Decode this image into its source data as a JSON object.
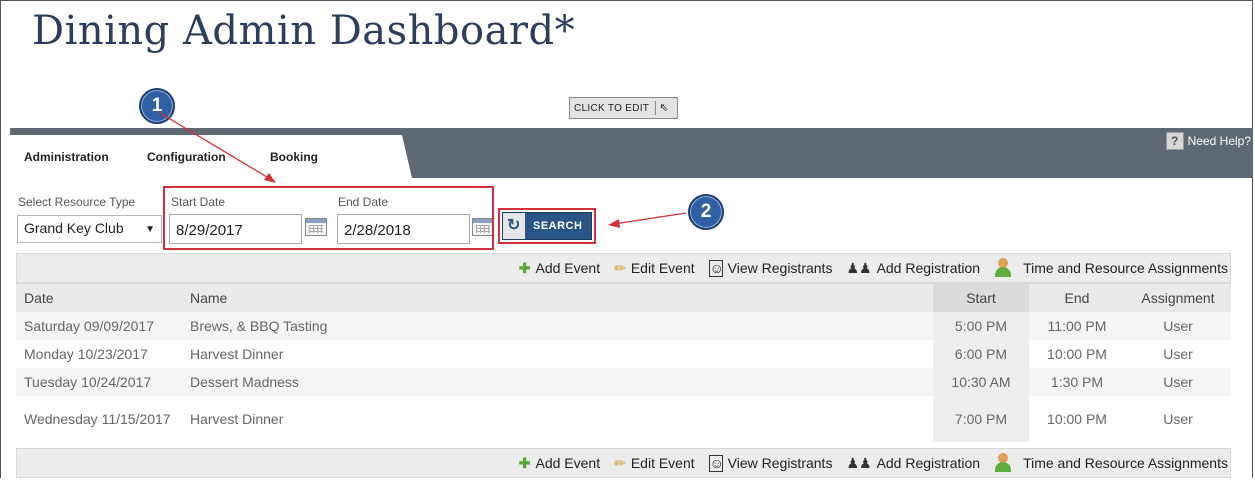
{
  "page": {
    "title": "Dining Admin Dashboard*"
  },
  "edit_button": {
    "label": "CLICK TO EDIT"
  },
  "tabs": [
    {
      "label": "Administration"
    },
    {
      "label": "Configuration"
    },
    {
      "label": "Booking"
    }
  ],
  "help": {
    "label": "Need Help?",
    "icon": "help-icon"
  },
  "filters": {
    "resource_label": "Select Resource Type",
    "resource_value": "Grand Key Club",
    "start_label": "Start Date",
    "start_value": "8/29/2017",
    "end_label": "End Date",
    "end_value": "2/28/2018",
    "search_label": "SEARCH"
  },
  "callouts": {
    "one": "1",
    "two": "2"
  },
  "toolbar": {
    "add_event": "Add Event",
    "edit_event": "Edit Event",
    "view_registrants": "View Registrants",
    "add_registration": "Add Registration",
    "assignments": "Time and Resource Assignments"
  },
  "table": {
    "columns": [
      "Date",
      "Name",
      "Start",
      "End",
      "Assignment"
    ],
    "rows": [
      {
        "date": "Saturday 09/09/2017",
        "name": "Brews, & BBQ Tasting",
        "start": "5:00 PM",
        "end": "11:00 PM",
        "assignment": "User"
      },
      {
        "date": "Monday 10/23/2017",
        "name": "Harvest Dinner",
        "start": "6:00 PM",
        "end": "10:00 PM",
        "assignment": "User"
      },
      {
        "date": "Tuesday 10/24/2017",
        "name": "Dessert Madness",
        "start": "10:30 AM",
        "end": "1:30 PM",
        "assignment": "User"
      },
      {
        "date": "Wednesday 11/15/2017",
        "name": "Harvest Dinner",
        "start": "7:00 PM",
        "end": "10:00 PM",
        "assignment": "User"
      }
    ]
  },
  "colors": {
    "accent": "#2b5486",
    "navbar": "#5d6873",
    "callout_red": "#d6303a"
  }
}
